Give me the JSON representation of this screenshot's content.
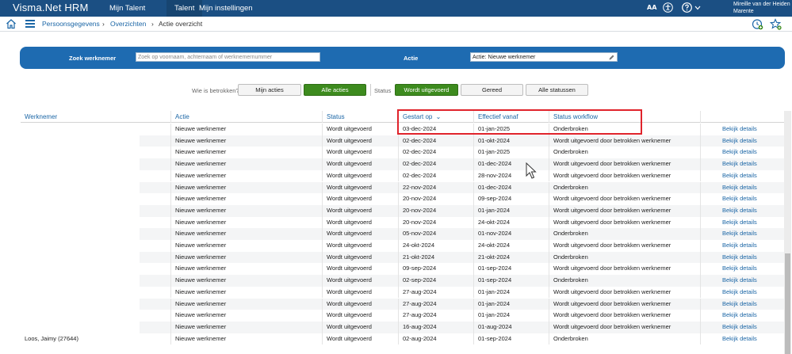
{
  "app": {
    "brand": "Visma.Net HRM"
  },
  "nav": {
    "items": [
      {
        "label": "Mijn Talent",
        "active": false
      },
      {
        "label": "Talent",
        "active": true
      },
      {
        "label": "Mijn instellingen",
        "active": false
      }
    ],
    "font_size_label": "AA",
    "user_line1": "Mireille van der Heiden",
    "user_line2": "Marente"
  },
  "breadcrumb": {
    "items": [
      "Persoonsgegevens",
      "Overzichten",
      "Actie overzicht"
    ],
    "separator": "›"
  },
  "filter": {
    "employee_label": "Zoek werknemer",
    "employee_placeholder": "Zoek op voornaam, achternaam of werknemernummer",
    "action_label": "Actie",
    "action_value": "Actie: Nieuwe werknemer"
  },
  "involved": {
    "label": "Wie is betrokken?",
    "buttons": [
      "Mijn acties",
      "Alle acties"
    ],
    "selected": "Alle acties"
  },
  "status_filter": {
    "label": "Status",
    "buttons": [
      "Wordt uitgevoerd",
      "Gereed",
      "Alle statussen"
    ],
    "selected": "Wordt uitgevoerd"
  },
  "table": {
    "columns": [
      "Werknemer",
      "Actie",
      "Status",
      "Gestart op",
      "Effectief vanaf",
      "Status workflow",
      ""
    ],
    "sort_column": "Gestart op",
    "sort_indicator": "⌄",
    "rows": [
      [
        "",
        "Nieuwe werknemer",
        "Wordt uitgevoerd",
        "03-dec-2024",
        "01-jan-2025",
        "Onderbroken",
        "Bekijk details"
      ],
      [
        "",
        "Nieuwe werknemer",
        "Wordt uitgevoerd",
        "02-dec-2024",
        "01-okt-2024",
        "Wordt uitgevoerd door betrokken werknemer",
        "Bekijk details"
      ],
      [
        "",
        "Nieuwe werknemer",
        "Wordt uitgevoerd",
        "02-dec-2024",
        "01-jan-2025",
        "Onderbroken",
        "Bekijk details"
      ],
      [
        "",
        "Nieuwe werknemer",
        "Wordt uitgevoerd",
        "02-dec-2024",
        "01-dec-2024",
        "Wordt uitgevoerd door betrokken werknemer",
        "Bekijk details"
      ],
      [
        "",
        "Nieuwe werknemer",
        "Wordt uitgevoerd",
        "02-dec-2024",
        "28-nov-2024",
        "Wordt uitgevoerd door betrokken werknemer",
        "Bekijk details"
      ],
      [
        "",
        "Nieuwe werknemer",
        "Wordt uitgevoerd",
        "22-nov-2024",
        "01-dec-2024",
        "Onderbroken",
        "Bekijk details"
      ],
      [
        "",
        "Nieuwe werknemer",
        "Wordt uitgevoerd",
        "20-nov-2024",
        "09-sep-2024",
        "Wordt uitgevoerd door betrokken werknemer",
        "Bekijk details"
      ],
      [
        "",
        "Nieuwe werknemer",
        "Wordt uitgevoerd",
        "20-nov-2024",
        "01-jan-2024",
        "Wordt uitgevoerd door betrokken werknemer",
        "Bekijk details"
      ],
      [
        "",
        "Nieuwe werknemer",
        "Wordt uitgevoerd",
        "20-nov-2024",
        "24-okt-2024",
        "Wordt uitgevoerd door betrokken werknemer",
        "Bekijk details"
      ],
      [
        "",
        "Nieuwe werknemer",
        "Wordt uitgevoerd",
        "05-nov-2024",
        "01-nov-2024",
        "Onderbroken",
        "Bekijk details"
      ],
      [
        "",
        "Nieuwe werknemer",
        "Wordt uitgevoerd",
        "24-okt-2024",
        "24-okt-2024",
        "Wordt uitgevoerd door betrokken werknemer",
        "Bekijk details"
      ],
      [
        "",
        "Nieuwe werknemer",
        "Wordt uitgevoerd",
        "21-okt-2024",
        "21-okt-2024",
        "Onderbroken",
        "Bekijk details"
      ],
      [
        "",
        "Nieuwe werknemer",
        "Wordt uitgevoerd",
        "09-sep-2024",
        "01-sep-2024",
        "Wordt uitgevoerd door betrokken werknemer",
        "Bekijk details"
      ],
      [
        "",
        "Nieuwe werknemer",
        "Wordt uitgevoerd",
        "02-sep-2024",
        "01-sep-2024",
        "Onderbroken",
        "Bekijk details"
      ],
      [
        "",
        "Nieuwe werknemer",
        "Wordt uitgevoerd",
        "27-aug-2024",
        "01-jan-2024",
        "Wordt uitgevoerd door betrokken werknemer",
        "Bekijk details"
      ],
      [
        "",
        "Nieuwe werknemer",
        "Wordt uitgevoerd",
        "27-aug-2024",
        "01-jan-2024",
        "Wordt uitgevoerd door betrokken werknemer",
        "Bekijk details"
      ],
      [
        "",
        "Nieuwe werknemer",
        "Wordt uitgevoerd",
        "27-aug-2024",
        "01-jan-2024",
        "Wordt uitgevoerd door betrokken werknemer",
        "Bekijk details"
      ],
      [
        "",
        "Nieuwe werknemer",
        "Wordt uitgevoerd",
        "16-aug-2024",
        "01-aug-2024",
        "Wordt uitgevoerd door betrokken werknemer",
        "Bekijk details"
      ],
      [
        "Loos, Jaimy (27644)",
        "Nieuwe werknemer",
        "Wordt uitgevoerd",
        "02-aug-2024",
        "01-sep-2024",
        "Onderbroken",
        "Bekijk details"
      ]
    ]
  },
  "colors": {
    "nav_bg": "#1b4f83",
    "panel_bg": "#1e6bb1",
    "link": "#1b66a6",
    "green": "#3d8b1e",
    "highlight": "#e0232b"
  }
}
